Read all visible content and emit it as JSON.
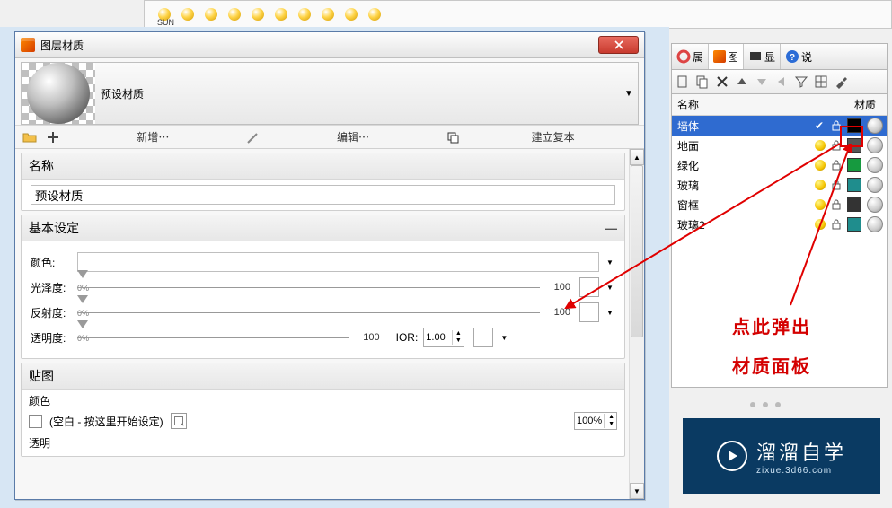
{
  "top_toolbar": {
    "sun_label": "SUN"
  },
  "dialog": {
    "title": "图层材质",
    "preset_label": "预设材质",
    "toolbar": {
      "new_label": "新增⋯",
      "edit_label": "编辑⋯",
      "copy_label": "建立复本"
    },
    "sections": {
      "name": {
        "title": "名称",
        "value": "预设材质"
      },
      "basic": {
        "title": "基本设定",
        "color_label": "颜色:",
        "gloss_label": "光泽度:",
        "gloss_zero": "0%",
        "gloss_max": "100",
        "reflect_label": "反射度:",
        "reflect_zero": "0%",
        "reflect_max": "100",
        "opacity_label": "透明度:",
        "opacity_zero": "0%",
        "opacity_max": "100",
        "ior_label": "IOR:",
        "ior_value": "1.00"
      },
      "map": {
        "title": "贴图",
        "color_label": "颜色",
        "empty_hint": "(空白 - 按这里开始设定)",
        "pct": "100%",
        "alpha_label": "透明"
      }
    }
  },
  "right_panel": {
    "tabs": {
      "t1": "属",
      "t2": "图",
      "t3": "显",
      "t4": "说"
    },
    "head_name": "名称",
    "head_mat": "材质",
    "rows": [
      {
        "name": "墙体",
        "selected": true,
        "check": true,
        "color": "#000000"
      },
      {
        "name": "地面",
        "selected": false,
        "color": "#555555"
      },
      {
        "name": "绿化",
        "selected": false,
        "color": "#169a3f"
      },
      {
        "name": "玻璃",
        "selected": false,
        "color": "#1f8d8d"
      },
      {
        "name": "窗框",
        "selected": false,
        "color": "#333333"
      },
      {
        "name": "玻璃2",
        "selected": false,
        "color": "#1f8d8d"
      }
    ]
  },
  "annotation": {
    "line1": "点此弹出",
    "line2": "材质面板"
  },
  "watermark": {
    "big": "溜溜自学",
    "small": "zixue.3d66.com"
  }
}
